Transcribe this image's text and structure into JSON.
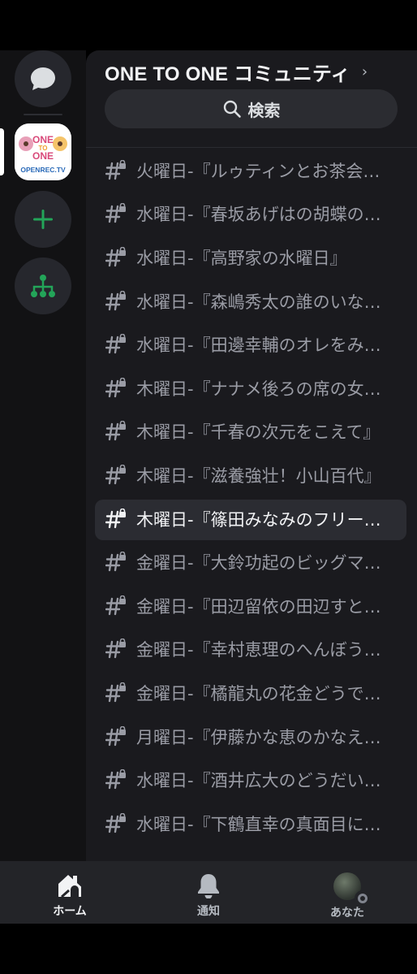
{
  "server": {
    "name": "ONE TO ONE コミュニティ",
    "logo_text_top": "ONE TO ONE",
    "logo_text_bottom": "OPENREC.TV"
  },
  "search": {
    "label": "検索"
  },
  "channels": [
    {
      "name": "火曜日-『ルゥティンとお茶会をしてやる』",
      "active": false,
      "locked": true
    },
    {
      "name": "水曜日-『春坂あげはの胡蝶の夢』",
      "active": false,
      "locked": true
    },
    {
      "name": "水曜日-『高野家の水曜日』",
      "active": false,
      "locked": true
    },
    {
      "name": "水曜日-『森嶋秀太の誰のいない部屋』",
      "active": false,
      "locked": true
    },
    {
      "name": "水曜日-『田邊幸輔のオレをみろ』",
      "active": false,
      "locked": true
    },
    {
      "name": "木曜日-『ナナメ後ろの席の女の子』",
      "active": false,
      "locked": true
    },
    {
      "name": "木曜日-『千春の次元をこえて』",
      "active": false,
      "locked": true
    },
    {
      "name": "木曜日-『滋養強壮！小山百代』",
      "active": false,
      "locked": true
    },
    {
      "name": "木曜日-『篠田みなみのフリートーク』",
      "active": true,
      "locked": true
    },
    {
      "name": "金曜日-『大鈴功起のビッグマウス』",
      "active": false,
      "locked": true
    },
    {
      "name": "金曜日-『田辺留依の田辺すとりーむ』",
      "active": false,
      "locked": true
    },
    {
      "name": "金曜日-『幸村恵理のへんぼうず』",
      "active": false,
      "locked": true
    },
    {
      "name": "金曜日-『橘龍丸の花金どうでしょう』",
      "active": false,
      "locked": true
    },
    {
      "name": "月曜日-『伊藤かな恵のかなえ時間』",
      "active": false,
      "locked": true
    },
    {
      "name": "水曜日-『酒井広大のどうだいこうだい』",
      "active": false,
      "locked": true
    },
    {
      "name": "水曜日-『下鶴直幸の真面目にやります』",
      "active": false,
      "locked": true
    }
  ],
  "tabs": [
    {
      "label": "ホーム",
      "icon": "home-icon",
      "active": true
    },
    {
      "label": "通知",
      "icon": "bell-icon",
      "active": false
    },
    {
      "label": "あなた",
      "icon": "avatar",
      "active": false
    }
  ],
  "colors": {
    "accent_green": "#23a559",
    "panel_bg": "#1a1a1e",
    "rail_bg": "#121214",
    "tab_bg": "#232428"
  }
}
